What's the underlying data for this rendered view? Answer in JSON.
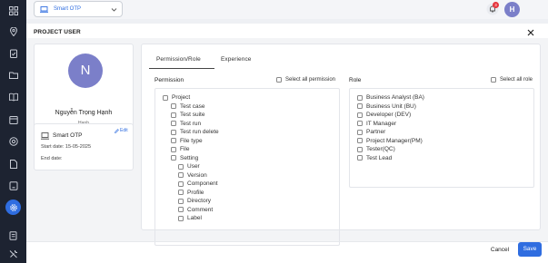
{
  "topbar": {
    "project_select": "Smart OTP",
    "notification_count": "3",
    "avatar_initial": "H"
  },
  "modal": {
    "title": "PROJECT USER"
  },
  "profile": {
    "initial": "N",
    "name": "Nguyễn Trọng Hạnh",
    "username": "Hạnh"
  },
  "project_card": {
    "name": "Smart OTP",
    "edit_label": "Edit",
    "start_date": "Start date:  15-05-2025",
    "end_date": "End date:"
  },
  "tabs": [
    {
      "label": "Permission/Role",
      "active": true
    },
    {
      "label": "Experience",
      "active": false
    }
  ],
  "permission": {
    "title": "Permission",
    "select_all": "Select all permission",
    "items": [
      {
        "label": "Project",
        "level": 0
      },
      {
        "label": "Test case",
        "level": 1
      },
      {
        "label": "Test suite",
        "level": 1
      },
      {
        "label": "Test run",
        "level": 1
      },
      {
        "label": "Test run delete",
        "level": 1
      },
      {
        "label": "File type",
        "level": 1
      },
      {
        "label": "File",
        "level": 1
      },
      {
        "label": "Setting",
        "level": 1
      },
      {
        "label": "User",
        "level": 2
      },
      {
        "label": "Version",
        "level": 2
      },
      {
        "label": "Component",
        "level": 2
      },
      {
        "label": "Profile",
        "level": 2
      },
      {
        "label": "Directory",
        "level": 2
      },
      {
        "label": "Comment",
        "level": 2
      },
      {
        "label": "Label",
        "level": 2
      }
    ]
  },
  "role": {
    "title": "Role",
    "select_all": "Select all role",
    "items": [
      "Business Analyst (BA)",
      "Business Unit (BU)",
      "Developer (DEV)",
      "IT Manager",
      "Partner",
      "Project Manager(PM)",
      "Tester(QC)",
      "Test Lead"
    ]
  },
  "footer": {
    "cancel_label": "Cancel",
    "save_label": "Save"
  },
  "colors": {
    "accent": "#2f6de0",
    "sidebar": "#1d2331",
    "avatar": "#7b7fc9"
  }
}
